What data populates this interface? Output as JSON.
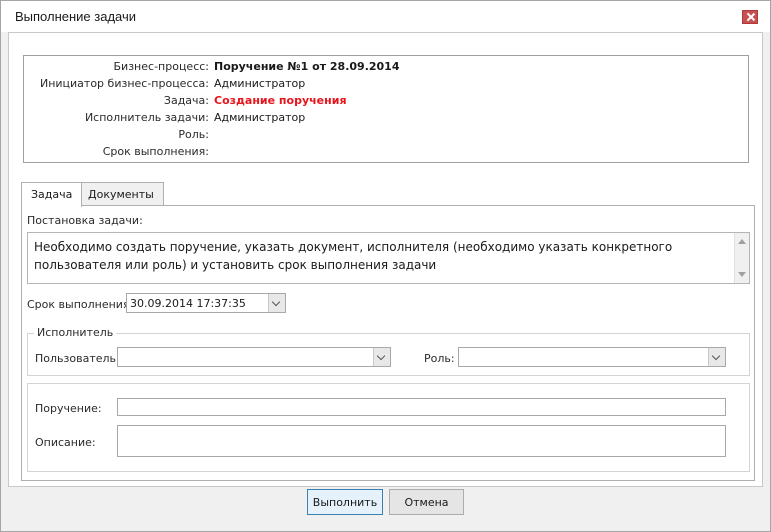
{
  "window": {
    "title": "Выполнение задачи"
  },
  "info": [
    {
      "label": "Бизнес-процесс:",
      "value": "Поручение №1 от 28.09.2014",
      "style": "bold"
    },
    {
      "label": "Инициатор бизнес-процесса:",
      "value": "Администратор",
      "style": "normal"
    },
    {
      "label": "Задача:",
      "value": "Создание поручения",
      "style": "red"
    },
    {
      "label": "Исполнитель задачи:",
      "value": "Администратор",
      "style": "normal"
    },
    {
      "label": "Роль:",
      "value": "",
      "style": "normal"
    },
    {
      "label": "Срок выполнения:",
      "value": "",
      "style": "normal"
    }
  ],
  "tabs": [
    {
      "label": "Задача",
      "active": true
    },
    {
      "label": "Документы",
      "active": false
    }
  ],
  "task": {
    "statement_label": "Постановка задачи:",
    "statement_line1": "Необходимо создать поручение, указать документ, исполнителя (необходимо указать конкретного",
    "statement_line2": "пользователя или роль) и установить срок выполнения задачи",
    "deadline_label": "Срок выполнения:",
    "deadline_value": "30.09.2014 17:37:35"
  },
  "executor": {
    "group_title": "Исполнитель",
    "user_label": "Пользователь:",
    "user_value": "",
    "role_label": "Роль:",
    "role_value": ""
  },
  "order": {
    "order_label": "Поручение:",
    "order_value": "",
    "description_label": "Описание:",
    "description_value": ""
  },
  "buttons": {
    "execute": "Выполнить",
    "cancel": "Отмена"
  },
  "colors": {
    "accent_red": "#e8141c",
    "default_button_border": "#3c7fb1"
  }
}
